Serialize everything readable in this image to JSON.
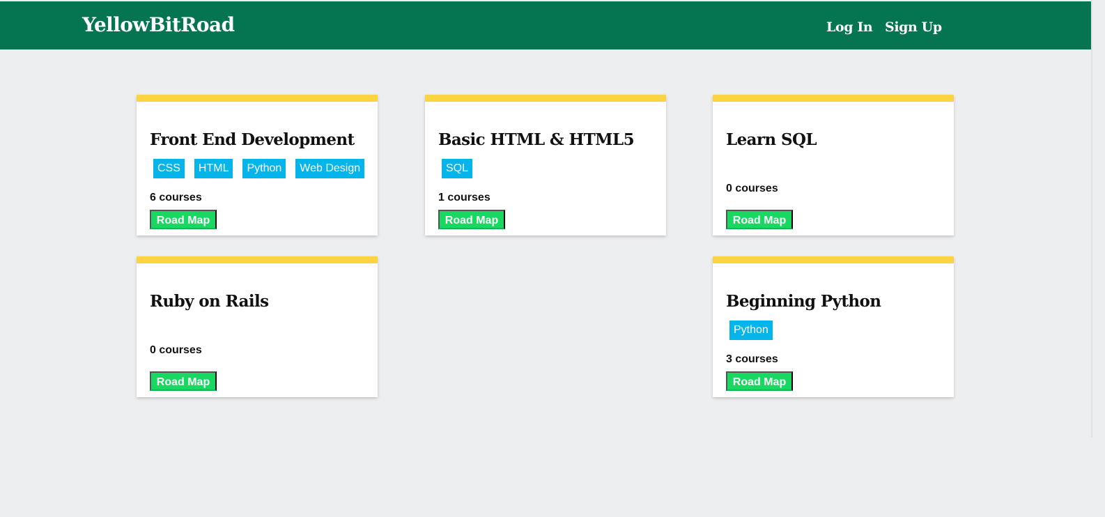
{
  "header": {
    "brand": "YellowBitRoad",
    "links": [
      {
        "label": "Log In"
      },
      {
        "label": "Sign Up"
      }
    ]
  },
  "colors": {
    "navbar": "#047451",
    "page_background": "#edeef0",
    "card_accent": "#fcd340",
    "tag": "#05b4ea",
    "roadmap_button": "#19d861"
  },
  "cards": [
    {
      "title": "Front End Development",
      "tags": [
        "CSS",
        "HTML",
        "Python",
        "Web Design"
      ],
      "count": "6 courses",
      "button": "Road Map"
    },
    {
      "title": "Basic HTML & HTML5",
      "tags": [
        "SQL"
      ],
      "count": "1 courses",
      "button": "Road Map"
    },
    {
      "title": "Learn SQL",
      "tags": [],
      "count": "0 courses",
      "button": "Road Map"
    },
    {
      "title": "Ruby on Rails",
      "tags": [],
      "count": "0 courses",
      "button": "Road Map"
    },
    {
      "title": "Beginning Python",
      "tags": [
        "Python"
      ],
      "count": "3 courses",
      "button": "Road Map"
    }
  ]
}
